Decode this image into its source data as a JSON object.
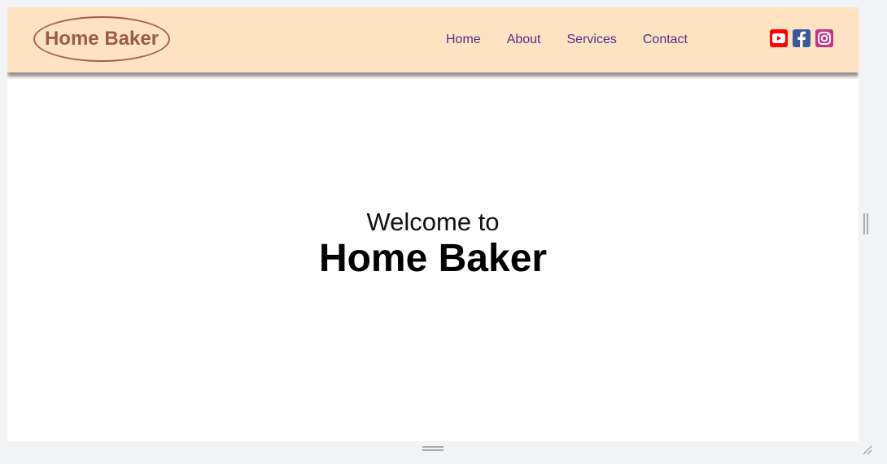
{
  "navbar": {
    "logo_text": "Home Baker",
    "links": [
      {
        "label": "Home"
      },
      {
        "label": "About"
      },
      {
        "label": "Services"
      },
      {
        "label": "Contact"
      }
    ],
    "social": [
      {
        "icon": "youtube-icon",
        "color": "#ff0000"
      },
      {
        "icon": "facebook-icon",
        "color": "#3b5998"
      },
      {
        "icon": "instagram-icon",
        "color": "#c13584"
      }
    ]
  },
  "hero": {
    "subtitle": "Welcome to",
    "title": "Home Baker"
  },
  "colors": {
    "navbar_bg": "#ffe2c2",
    "logo": "#9a5c49",
    "link": "#5a2a8a"
  }
}
